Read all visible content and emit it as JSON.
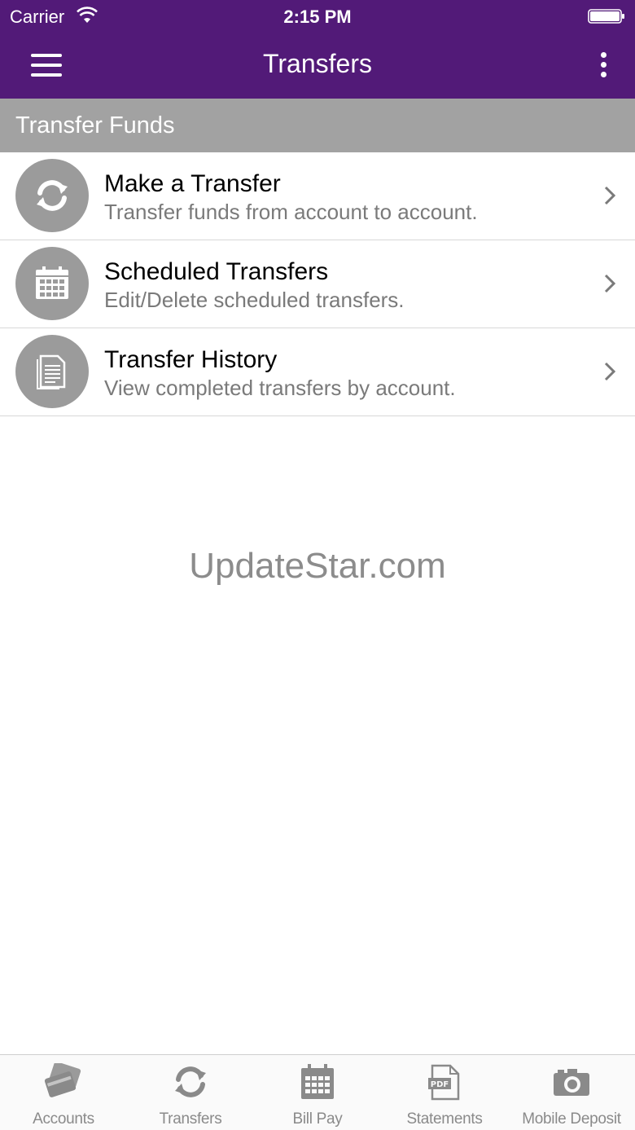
{
  "status_bar": {
    "carrier": "Carrier",
    "time": "2:15 PM",
    "wifi_icon": "wifi-icon",
    "battery_icon": "battery-icon"
  },
  "header": {
    "title": "Transfers",
    "menu_icon": "hamburger-menu-icon",
    "more_icon": "more-vertical-icon"
  },
  "section": {
    "title": "Transfer Funds"
  },
  "items": [
    {
      "title": "Make a Transfer",
      "subtitle": "Transfer funds from account to account.",
      "icon": "refresh-icon"
    },
    {
      "title": "Scheduled Transfers",
      "subtitle": "Edit/Delete scheduled transfers.",
      "icon": "calendar-icon"
    },
    {
      "title": "Transfer History",
      "subtitle": "View completed transfers by account.",
      "icon": "document-icon"
    }
  ],
  "watermark": "UpdateStar.com",
  "tabs": [
    {
      "label": "Accounts",
      "icon": "cards-icon"
    },
    {
      "label": "Transfers",
      "icon": "refresh-icon"
    },
    {
      "label": "Bill Pay",
      "icon": "calendar-icon"
    },
    {
      "label": "Statements",
      "icon": "pdf-icon"
    },
    {
      "label": "Mobile Deposit",
      "icon": "camera-icon"
    }
  ],
  "colors": {
    "header_bg": "#521a78",
    "section_bg": "#a2a2a2",
    "icon_circle": "#9b9b9b"
  }
}
